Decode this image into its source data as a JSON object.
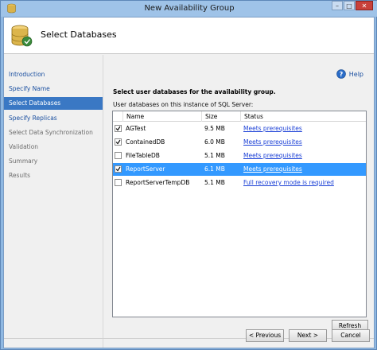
{
  "window": {
    "title": "New Availability Group",
    "minimize": "–",
    "maximize": "□",
    "close": "✕"
  },
  "header": {
    "title": "Select Databases"
  },
  "nav": {
    "items": [
      {
        "label": "Introduction",
        "state": "link"
      },
      {
        "label": "Specify Name",
        "state": "link"
      },
      {
        "label": "Select Databases",
        "state": "selected"
      },
      {
        "label": "Specify Replicas",
        "state": "link"
      },
      {
        "label": "Select Data Synchronization",
        "state": "disabled"
      },
      {
        "label": "Validation",
        "state": "disabled"
      },
      {
        "label": "Summary",
        "state": "disabled"
      },
      {
        "label": "Results",
        "state": "disabled"
      }
    ]
  },
  "main": {
    "help": "Help",
    "instruction": "Select user databases for the availability group.",
    "list_label": "User databases on this instance of SQL Server:",
    "columns": {
      "name": "Name",
      "size": "Size",
      "status": "Status"
    },
    "rows": [
      {
        "checked": true,
        "name": "AGTest",
        "size": "9.5 MB",
        "status": "Meets prerequisites",
        "selected": false
      },
      {
        "checked": true,
        "name": "ContainedDB",
        "size": "6.0 MB",
        "status": "Meets prerequisites",
        "selected": false
      },
      {
        "checked": false,
        "name": "FileTableDB",
        "size": "5.1 MB",
        "status": "Meets prerequisites",
        "selected": false
      },
      {
        "checked": true,
        "name": "ReportServer",
        "size": "6.1 MB",
        "status": "Meets prerequisites",
        "selected": true
      },
      {
        "checked": false,
        "name": "ReportServerTempDB",
        "size": "5.1 MB",
        "status": "Full recovery mode is required",
        "selected": false
      }
    ],
    "refresh": "Refresh"
  },
  "footer": {
    "previous": "< Previous",
    "next": "Next >",
    "cancel": "Cancel"
  },
  "colors": {
    "selected_nav": "#3a78c4",
    "selected_row": "#3399ff",
    "link": "#1a4fa0"
  }
}
